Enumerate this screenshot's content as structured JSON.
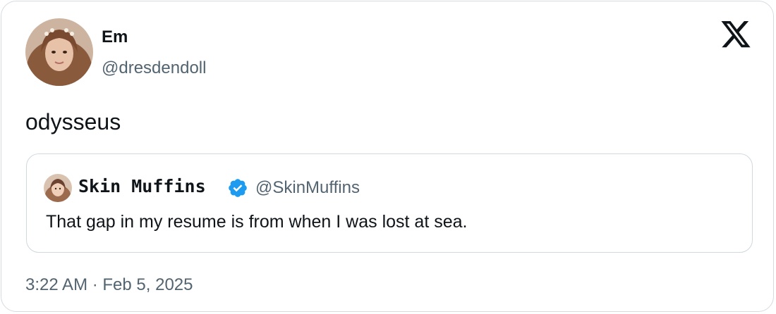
{
  "tweet": {
    "author": {
      "display_name": "Em",
      "handle": "@dresdendoll"
    },
    "text": "odysseus",
    "quoted": {
      "display_name": "Skin Muffins",
      "handle": "@SkinMuffins",
      "verified": true,
      "text": "That gap in my resume is from when I was lost at sea."
    },
    "timestamp": "3:22 AM · Feb 5, 2025"
  },
  "icons": {
    "brand": "x-logo-icon",
    "verified": "verified-badge-icon"
  },
  "colors": {
    "text_primary": "#0f1419",
    "text_secondary": "#536471",
    "border": "#cfd9de",
    "verified_blue": "#1d9bf0"
  }
}
